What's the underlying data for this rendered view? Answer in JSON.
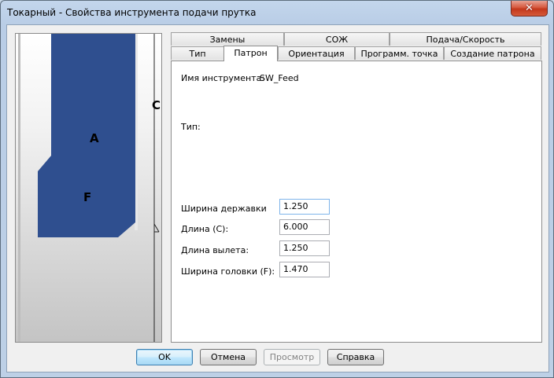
{
  "window": {
    "title": "Токарный - Свойства инструмента подачи прутка",
    "close_glyph": "✕"
  },
  "preview": {
    "label_a": "A",
    "label_f": "F",
    "label_c": "C",
    "tool_color": "#2f4f8f"
  },
  "tabs": {
    "row1": [
      "Замены",
      "СОЖ",
      "Подача/Скорость"
    ],
    "row2": [
      "Тип",
      "Патрон",
      "Ориентация",
      "Программ. точка",
      "Создание патрона"
    ],
    "active": "Патрон"
  },
  "panel": {
    "tool_name_label": "Имя инструмента:",
    "tool_name_value": "SW_Feed",
    "type_label": "Тип:",
    "fields": [
      {
        "label": "Ширина державки",
        "value": "1.250"
      },
      {
        "label": "Длина (C):",
        "value": "6.000"
      },
      {
        "label": "Длина вылета:",
        "value": "1.250"
      },
      {
        "label": "Ширина головки (F):",
        "value": "1.470"
      }
    ]
  },
  "buttons": {
    "ok": "OK",
    "cancel": "Отмена",
    "preview": "Просмотр",
    "help": "Справка"
  }
}
